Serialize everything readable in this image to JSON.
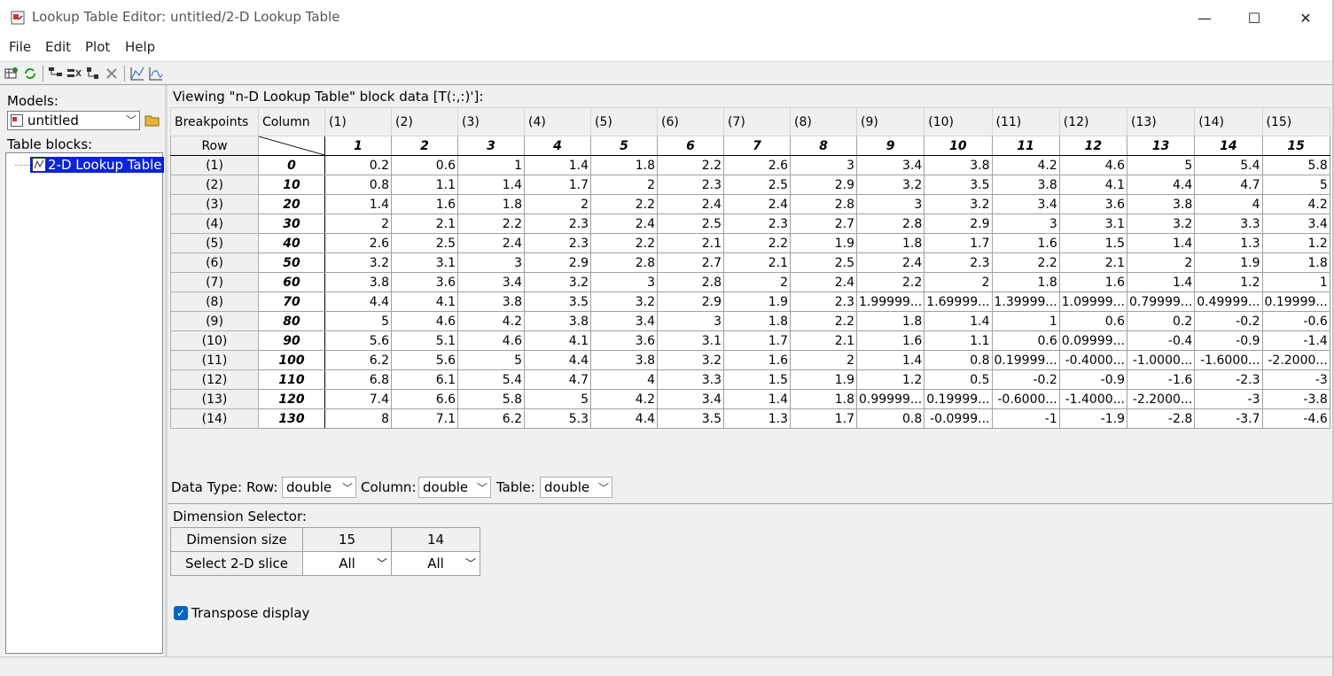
{
  "window": {
    "title": "Lookup Table Editor: untitled/2-D Lookup Table",
    "minimize": "—",
    "maximize": "☐",
    "close": "✕"
  },
  "menu": [
    "File",
    "Edit",
    "Plot",
    "Help"
  ],
  "toolbar": {
    "icons": [
      "table-settings-icon",
      "refresh-icon",
      "hierarchy-icon",
      "remove-row-icon",
      "add-breakpoint-icon",
      "delete-icon",
      "line-plot-icon",
      "mesh-plot-icon"
    ]
  },
  "left": {
    "models_label": "Models:",
    "model_value": "untitled",
    "table_blocks_label": "Table blocks:",
    "tree_item": "2-D Lookup Table"
  },
  "viewing_text": "Viewing \"n-D Lookup Table\" block data [T(:,:)']:",
  "table": {
    "breakpoints_label": "Breakpoints",
    "column_label": "Column",
    "row_label": "Row",
    "col_indices": [
      "(1)",
      "(2)",
      "(3)",
      "(4)",
      "(5)",
      "(6)",
      "(7)",
      "(8)",
      "(9)",
      "(10)",
      "(11)",
      "(12)",
      "(13)",
      "(14)",
      "(15)"
    ],
    "col_breakpoints": [
      "1",
      "2",
      "3",
      "4",
      "5",
      "6",
      "7",
      "8",
      "9",
      "10",
      "11",
      "12",
      "13",
      "14",
      "15"
    ],
    "rows": [
      {
        "idx": "(1)",
        "bp": "0",
        "vals": [
          "0.2",
          "0.6",
          "1",
          "1.4",
          "1.8",
          "2.2",
          "2.6",
          "3",
          "3.4",
          "3.8",
          "4.2",
          "4.6",
          "5",
          "5.4",
          "5.8"
        ]
      },
      {
        "idx": "(2)",
        "bp": "10",
        "vals": [
          "0.8",
          "1.1",
          "1.4",
          "1.7",
          "2",
          "2.3",
          "2.5",
          "2.9",
          "3.2",
          "3.5",
          "3.8",
          "4.1",
          "4.4",
          "4.7",
          "5"
        ]
      },
      {
        "idx": "(3)",
        "bp": "20",
        "vals": [
          "1.4",
          "1.6",
          "1.8",
          "2",
          "2.2",
          "2.4",
          "2.4",
          "2.8",
          "3",
          "3.2",
          "3.4",
          "3.6",
          "3.8",
          "4",
          "4.2"
        ]
      },
      {
        "idx": "(4)",
        "bp": "30",
        "vals": [
          "2",
          "2.1",
          "2.2",
          "2.3",
          "2.4",
          "2.5",
          "2.3",
          "2.7",
          "2.8",
          "2.9",
          "3",
          "3.1",
          "3.2",
          "3.3",
          "3.4"
        ]
      },
      {
        "idx": "(5)",
        "bp": "40",
        "vals": [
          "2.6",
          "2.5",
          "2.4",
          "2.3",
          "2.2",
          "2.1",
          "2.2",
          "1.9",
          "1.8",
          "1.7",
          "1.6",
          "1.5",
          "1.4",
          "1.3",
          "1.2"
        ]
      },
      {
        "idx": "(6)",
        "bp": "50",
        "vals": [
          "3.2",
          "3.1",
          "3",
          "2.9",
          "2.8",
          "2.7",
          "2.1",
          "2.5",
          "2.4",
          "2.3",
          "2.2",
          "2.1",
          "2",
          "1.9",
          "1.8"
        ]
      },
      {
        "idx": "(7)",
        "bp": "60",
        "vals": [
          "3.8",
          "3.6",
          "3.4",
          "3.2",
          "3",
          "2.8",
          "2",
          "2.4",
          "2.2",
          "2",
          "1.8",
          "1.6",
          "1.4",
          "1.2",
          "1"
        ]
      },
      {
        "idx": "(8)",
        "bp": "70",
        "vals": [
          "4.4",
          "4.1",
          "3.8",
          "3.5",
          "3.2",
          "2.9",
          "1.9",
          "2.3",
          "1.99999...",
          "1.69999...",
          "1.39999...",
          "1.09999...",
          "0.79999...",
          "0.49999...",
          "0.19999..."
        ]
      },
      {
        "idx": "(9)",
        "bp": "80",
        "vals": [
          "5",
          "4.6",
          "4.2",
          "3.8",
          "3.4",
          "3",
          "1.8",
          "2.2",
          "1.8",
          "1.4",
          "1",
          "0.6",
          "0.2",
          "-0.2",
          "-0.6"
        ]
      },
      {
        "idx": "(10)",
        "bp": "90",
        "vals": [
          "5.6",
          "5.1",
          "4.6",
          "4.1",
          "3.6",
          "3.1",
          "1.7",
          "2.1",
          "1.6",
          "1.1",
          "0.6",
          "0.09999...",
          "-0.4",
          "-0.9",
          "-1.4"
        ]
      },
      {
        "idx": "(11)",
        "bp": "100",
        "vals": [
          "6.2",
          "5.6",
          "5",
          "4.4",
          "3.8",
          "3.2",
          "1.6",
          "2",
          "1.4",
          "0.8",
          "0.19999...",
          "-0.4000...",
          "-1.0000...",
          "-1.6000...",
          "-2.2000..."
        ]
      },
      {
        "idx": "(12)",
        "bp": "110",
        "vals": [
          "6.8",
          "6.1",
          "5.4",
          "4.7",
          "4",
          "3.3",
          "1.5",
          "1.9",
          "1.2",
          "0.5",
          "-0.2",
          "-0.9",
          "-1.6",
          "-2.3",
          "-3"
        ]
      },
      {
        "idx": "(13)",
        "bp": "120",
        "vals": [
          "7.4",
          "6.6",
          "5.8",
          "5",
          "4.2",
          "3.4",
          "1.4",
          "1.8",
          "0.99999...",
          "0.19999...",
          "-0.6000...",
          "-1.4000...",
          "-2.2000...",
          "-3",
          "-3.8"
        ]
      },
      {
        "idx": "(14)",
        "bp": "130",
        "vals": [
          "8",
          "7.1",
          "6.2",
          "5.3",
          "4.4",
          "3.5",
          "1.3",
          "1.7",
          "0.8",
          "-0.0999...",
          "-1",
          "-1.9",
          "-2.8",
          "-3.7",
          "-4.6"
        ]
      }
    ]
  },
  "datatype": {
    "label": "Data Type:",
    "row_label": "Row:",
    "row_value": "double",
    "column_label": "Column:",
    "column_value": "double",
    "table_label": "Table:",
    "table_value": "double"
  },
  "dimension": {
    "label": "Dimension Selector:",
    "size_label": "Dimension size",
    "size_1": "15",
    "size_2": "14",
    "slice_label": "Select 2-D slice",
    "slice_1": "All",
    "slice_2": "All"
  },
  "transpose": {
    "label": "Transpose display",
    "checked": "✓"
  }
}
